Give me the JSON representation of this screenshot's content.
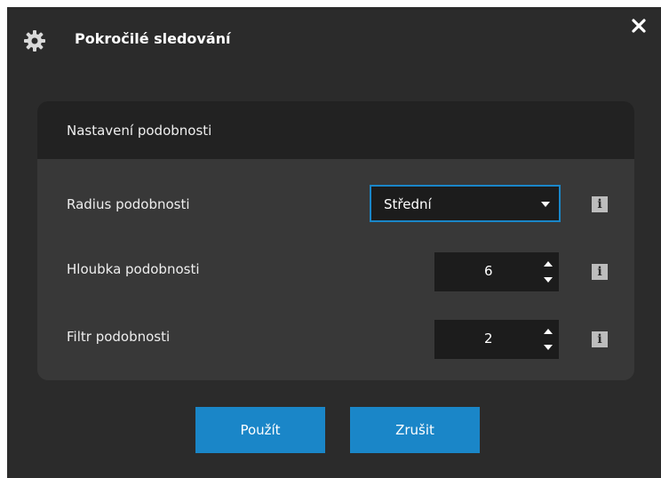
{
  "dialog": {
    "title": "Pokročilé sledování",
    "settings_icon": "gear-icon",
    "close_icon": "close-icon"
  },
  "panel": {
    "title": "Nastavení podobnosti",
    "rows": [
      {
        "label": "Radius podobnosti",
        "control": "select",
        "value": "Střední"
      },
      {
        "label": "Hloubka podobnosti",
        "control": "spinner",
        "value": "6"
      },
      {
        "label": "Filtr podobnosti",
        "control": "spinner",
        "value": "2"
      }
    ],
    "info_icon": "info-icon"
  },
  "buttons": {
    "apply_label": "Použít",
    "cancel_label": "Zrušit"
  },
  "colors": {
    "dialog_bg": "#2b2b2b",
    "panel_bg": "#383838",
    "panel_header_bg": "#222222",
    "accent": "#1a86c8",
    "field_bg": "#1c1c1c"
  }
}
